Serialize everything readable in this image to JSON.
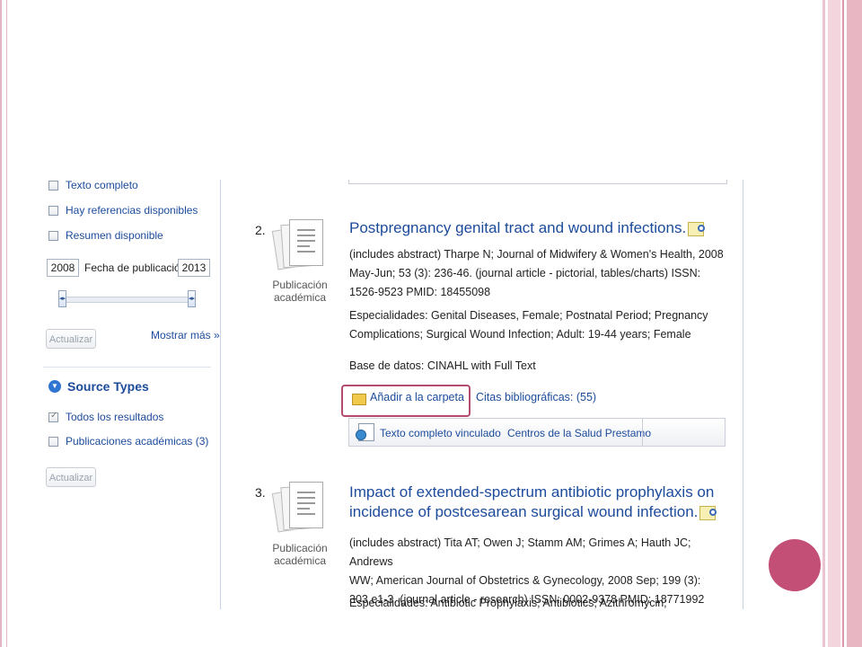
{
  "sidebar": {
    "filters": [
      {
        "label": "Texto completo",
        "checked": false
      },
      {
        "label": "Hay referencias disponibles",
        "checked": false
      },
      {
        "label": "Resumen disponible",
        "checked": false
      }
    ],
    "date_from": "2008",
    "date_label": "Fecha de publicación",
    "date_to": "2013",
    "update_label": "Actualizar",
    "show_more": "Mostrar más »",
    "source_types_title": "Source Types",
    "source_types": [
      {
        "label": "Todos los resultados",
        "checked": true
      },
      {
        "label": "Publicaciones académicas (3)",
        "checked": false
      }
    ],
    "update_label_2": "Actualizar"
  },
  "results": [
    {
      "number": "2.",
      "pub_type_line1": "Publicación",
      "pub_type_line2": "académica",
      "title_line1": "Postpregnancy genital tract and wound infections.",
      "abstract_lines": [
        "(includes abstract) Tharpe N; Journal of Midwifery & Women's Health, 2008",
        "May-Jun; 53 (3): 236-46. (journal article - pictorial, tables/charts) ISSN:",
        "1526-9523 PMID: 18455098"
      ],
      "specialties_lines": [
        "Especialidades: Genital Diseases, Female; Postnatal Period; Pregnancy",
        "Complications; Surgical Wound Infection; Adult: 19-44 years; Female"
      ],
      "database": "Base de datos: CINAHL with Full Text",
      "add_folder": "Añadir a la carpeta",
      "citations": "Citas bibliográficas: (55)",
      "linked_fulltext": "Texto completo vinculado",
      "centros": "Centros de la Salud Prestamo"
    },
    {
      "number": "3.",
      "pub_type_line1": "Publicación",
      "pub_type_line2": "académica",
      "title_line1": "Impact of extended-spectrum antibiotic prophylaxis on",
      "title_line2": "incidence of postcesarean surgical wound infection.",
      "abstract_lines": [
        "(includes abstract) Tita AT; Owen J; Stamm AM; Grimes A; Hauth JC; Andrews",
        "WW; American Journal of Obstetrics & Gynecology, 2008 Sep; 199 (3):",
        "303.e1-3. (journal article - research) ISSN: 0002-9378 PMID: 18771992"
      ],
      "specialties_lines": [
        "Especialidades: Antibiotic Prophylaxis; Antibiotics; Azithromycin; Cephalosporins;"
      ]
    }
  ],
  "colors": {
    "link": "#1c4b9c",
    "highlight": "#b44b71",
    "accent_dot": "#c44f76"
  }
}
